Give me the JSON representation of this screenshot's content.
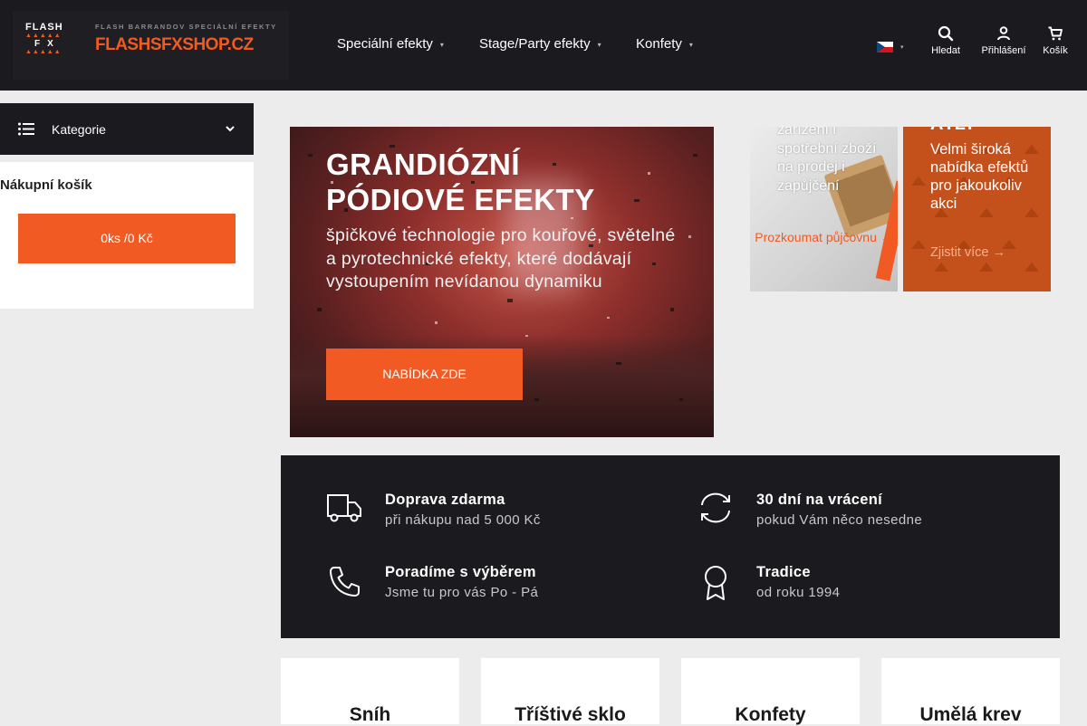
{
  "header": {
    "logo": {
      "mark_top": "FLASH",
      "mark_mid": "FX",
      "tagline": "FLASH BARRANDOV SPECIÁLNÍ EFEKTY",
      "name": "FLASHSFXSHOP.CZ"
    },
    "nav": [
      {
        "label": "Speciální efekty"
      },
      {
        "label": "Stage/Party efekty"
      },
      {
        "label": "Konfety"
      }
    ],
    "more_glyph": "",
    "language": "cs",
    "actions": {
      "search": "Hledat",
      "login": "Přihlášení",
      "cart": "Košík"
    }
  },
  "sidebar": {
    "categories_label": "Kategorie",
    "cart_title": "Nákupní košík",
    "cart_summary": "0ks /0 Kč"
  },
  "hero": {
    "title_line1": "GRANDIÓZNÍ",
    "title_line2": "PÓDIOVÉ EFEKTY",
    "text": "špičkové technologie pro kouřové, světelné a pyrotechnické efekty, které dodávají vystoupením nevídanou dynamiku",
    "next_glyph": "",
    "cta": "NABÍDKA ZDE"
  },
  "promos": [
    {
      "text": "zařízení i spotřební zboží na prodej i zapůjčení",
      "link": "Prozkoumat půjčovnu →"
    },
    {
      "heading": "ÁTLY",
      "text": "Velmi široká nabídka efektů pro jakoukoliv akci",
      "link": "Zjistit více →"
    }
  ],
  "benefits": [
    {
      "title": "Doprava zdarma",
      "subtitle": "při nákupu nad 5 000 Kč",
      "icon": "truck-icon"
    },
    {
      "title": "30 dní na vrácení",
      "subtitle": "pokud Vám něco nesedne",
      "icon": "return-icon"
    },
    {
      "title": "Poradíme s výběrem",
      "subtitle": "Jsme tu pro vás Po - Pá",
      "icon": "phone-icon"
    },
    {
      "title": "Tradice",
      "subtitle": "od roku 1994",
      "icon": "award-icon"
    }
  ],
  "categories": [
    {
      "title": "Sníh"
    },
    {
      "title": "Tříštivé sklo"
    },
    {
      "title": "Konfety"
    },
    {
      "title": "Umělá krev"
    }
  ],
  "colors": {
    "accent": "#f15a22",
    "dark": "#1b1a1f",
    "background": "#ececec"
  }
}
